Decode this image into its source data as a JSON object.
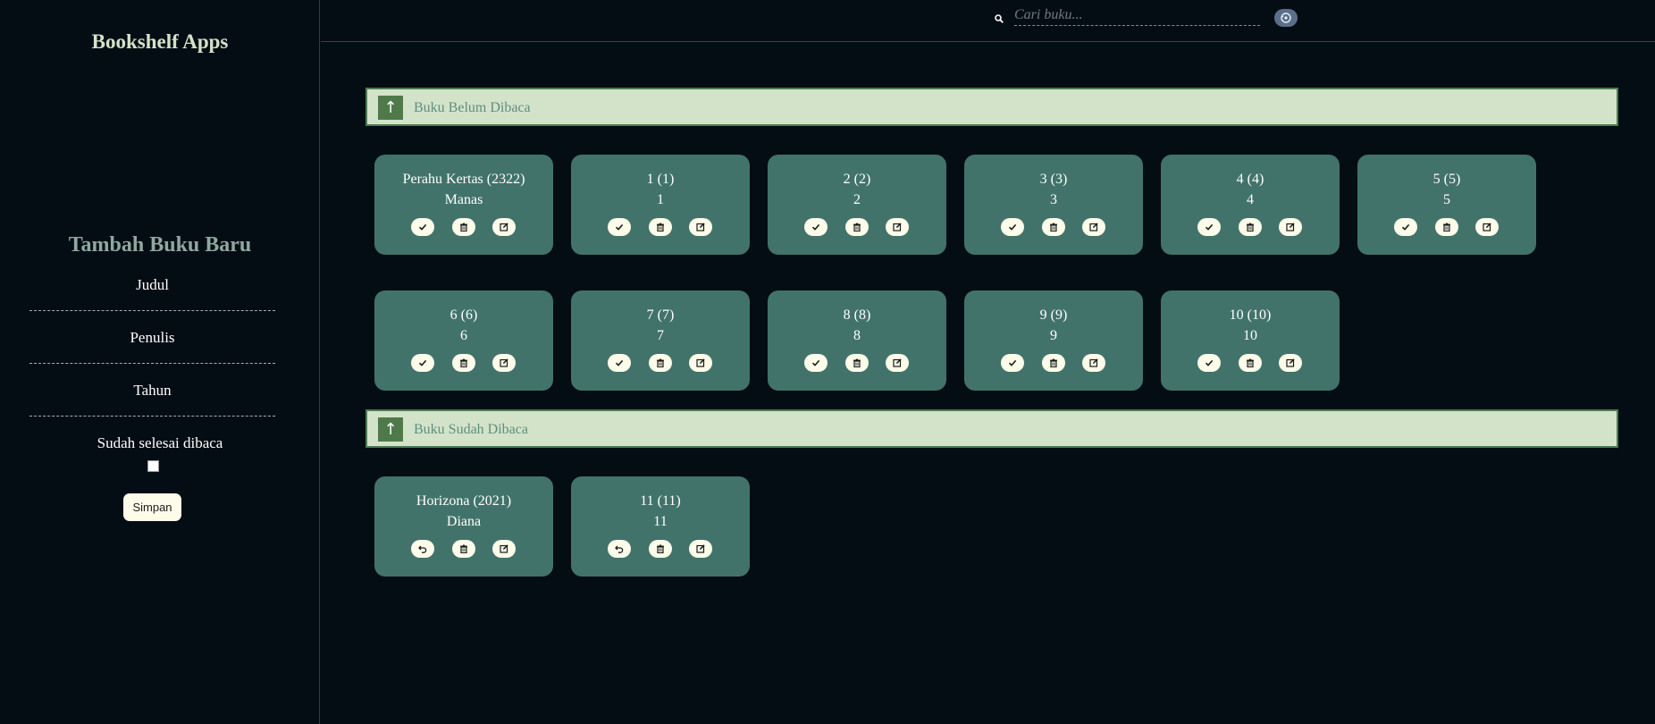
{
  "app": {
    "title": "Bookshelf Apps"
  },
  "form": {
    "title": "Tambah Buku Baru",
    "fields": [
      {
        "label": "Judul"
      },
      {
        "label": "Penulis"
      },
      {
        "label": "Tahun"
      }
    ],
    "checkbox_label": "Sudah selesai dibaca",
    "checkbox_checked": false,
    "submit_label": "Simpan"
  },
  "search": {
    "placeholder": "Cari buku...",
    "icon": "search-icon",
    "button_icon": "refresh-icon"
  },
  "shelves": [
    {
      "title": "Buku Belum Dibaca",
      "toggle_icon": "arrow-up-icon",
      "books": [
        {
          "title": "Perahu Kertas (2322)",
          "author": "Manas"
        },
        {
          "title": "1 (1)",
          "author": "1"
        },
        {
          "title": "2 (2)",
          "author": "2"
        },
        {
          "title": "3 (3)",
          "author": "3"
        },
        {
          "title": "4 (4)",
          "author": "4"
        },
        {
          "title": "5 (5)",
          "author": "5"
        },
        {
          "title": "6 (6)",
          "author": "6"
        },
        {
          "title": "7 (7)",
          "author": "7"
        },
        {
          "title": "8 (8)",
          "author": "8"
        },
        {
          "title": "9 (9)",
          "author": "9"
        },
        {
          "title": "10 (10)",
          "author": "10"
        }
      ],
      "actions": [
        "check-icon",
        "trash-icon",
        "edit-icon"
      ]
    },
    {
      "title": "Buku Sudah Dibaca",
      "toggle_icon": "arrow-up-icon",
      "books": [
        {
          "title": "Horizona (2021)",
          "author": "Diana"
        },
        {
          "title": "11 (11)",
          "author": "11"
        }
      ],
      "actions": [
        "undo-icon",
        "trash-icon",
        "edit-icon"
      ]
    }
  ],
  "colors": {
    "background": "#050d14",
    "card": "#42736a",
    "section_header": "#d3e3c9",
    "accent": "#4e7a4a"
  }
}
